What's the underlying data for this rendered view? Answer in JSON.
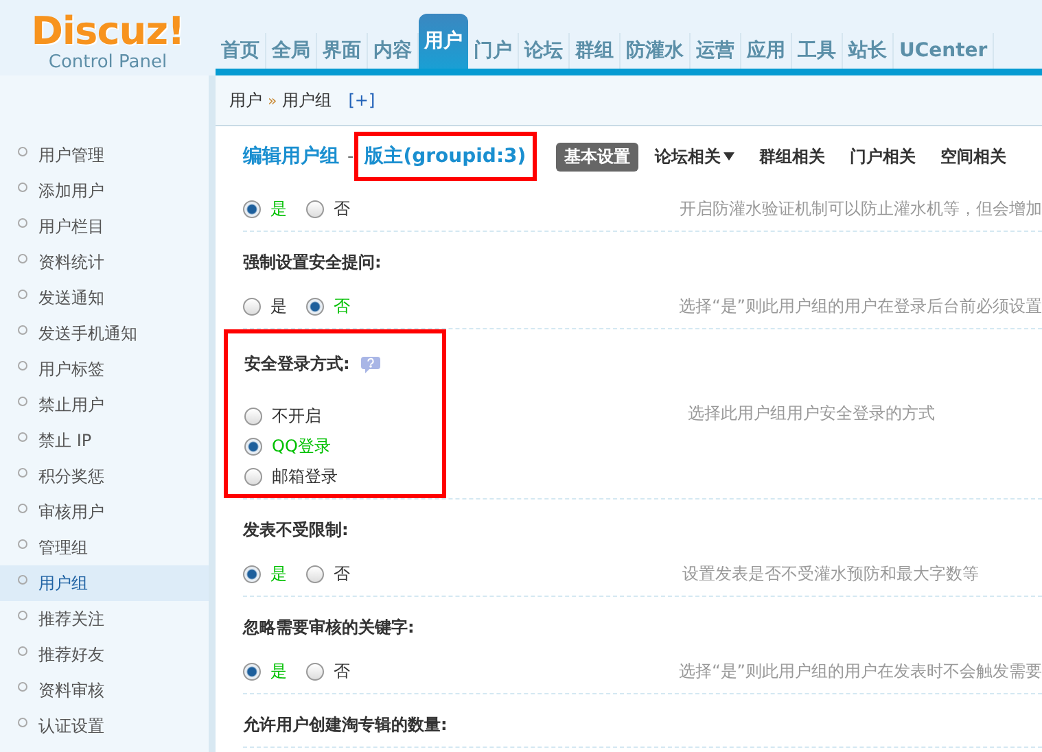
{
  "logo": {
    "name": "Discuz!",
    "subtitle": "Control Panel"
  },
  "nav": [
    {
      "label": "首页",
      "selected": false
    },
    {
      "label": "全局",
      "selected": false
    },
    {
      "label": "界面",
      "selected": false
    },
    {
      "label": "内容",
      "selected": false
    },
    {
      "label": "用户",
      "selected": true
    },
    {
      "label": "门户",
      "selected": false
    },
    {
      "label": "论坛",
      "selected": false
    },
    {
      "label": "群组",
      "selected": false
    },
    {
      "label": "防灌水",
      "selected": false
    },
    {
      "label": "运营",
      "selected": false
    },
    {
      "label": "应用",
      "selected": false
    },
    {
      "label": "工具",
      "selected": false
    },
    {
      "label": "站长",
      "selected": false
    },
    {
      "label": "UCenter",
      "selected": false
    }
  ],
  "breadcrumb": {
    "items": [
      "用户",
      "用户组"
    ],
    "separator": "»",
    "add": "[+]"
  },
  "sidebar": {
    "items": [
      {
        "label": "用户管理",
        "selected": false
      },
      {
        "label": "添加用户",
        "selected": false
      },
      {
        "label": "用户栏目",
        "selected": false
      },
      {
        "label": "资料统计",
        "selected": false
      },
      {
        "label": "发送通知",
        "selected": false
      },
      {
        "label": "发送手机通知",
        "selected": false
      },
      {
        "label": "用户标签",
        "selected": false
      },
      {
        "label": "禁止用户",
        "selected": false
      },
      {
        "label": "禁止 IP",
        "selected": false
      },
      {
        "label": "积分奖惩",
        "selected": false
      },
      {
        "label": "审核用户",
        "selected": false
      },
      {
        "label": "管理组",
        "selected": false
      },
      {
        "label": "用户组",
        "selected": true
      },
      {
        "label": "推荐关注",
        "selected": false
      },
      {
        "label": "推荐好友",
        "selected": false
      },
      {
        "label": "资料审核",
        "selected": false
      },
      {
        "label": "认证设置",
        "selected": false
      }
    ]
  },
  "title": {
    "text": "编辑用户组",
    "separator": "-",
    "group": "版主(groupid:3)",
    "highlighted": true
  },
  "subtabs": [
    {
      "label": "基本设置",
      "selected": true,
      "dropdown": false
    },
    {
      "label": "论坛相关",
      "selected": false,
      "dropdown": true
    },
    {
      "label": "群组相关",
      "selected": false,
      "dropdown": false
    },
    {
      "label": "门户相关",
      "selected": false,
      "dropdown": false
    },
    {
      "label": "空间相关",
      "selected": false,
      "dropdown": false
    }
  ],
  "settings": [
    {
      "kind": "inline",
      "highlighted": false,
      "options": [
        {
          "label": "是",
          "selected": true
        },
        {
          "label": "否",
          "selected": false
        }
      ],
      "description": "开启防灌水验证机制可以防止灌水机等，但会增加"
    },
    {
      "label": "强制设置安全提问:",
      "kind": "inline",
      "highlighted": false,
      "help": false,
      "options": [
        {
          "label": "是",
          "selected": false
        },
        {
          "label": "否",
          "selected": true
        }
      ],
      "description": "选择“是”则此用户组的用户在登录后台前必须设置"
    },
    {
      "label": "安全登录方式:",
      "kind": "stacked",
      "highlighted": true,
      "help": true,
      "options": [
        {
          "label": "不开启",
          "selected": false
        },
        {
          "label": "QQ登录",
          "selected": true
        },
        {
          "label": "邮箱登录",
          "selected": false
        }
      ],
      "description": "选择此用户组用户安全登录的方式"
    },
    {
      "label": "发表不受限制:",
      "kind": "inline",
      "highlighted": false,
      "help": false,
      "options": [
        {
          "label": "是",
          "selected": true
        },
        {
          "label": "否",
          "selected": false
        }
      ],
      "description": "设置发表是否不受灌水预防和最大字数等"
    },
    {
      "label": "忽略需要审核的关键字:",
      "kind": "inline",
      "highlighted": false,
      "help": false,
      "options": [
        {
          "label": "是",
          "selected": true
        },
        {
          "label": "否",
          "selected": false
        }
      ],
      "description": "选择“是”则此用户组的用户在发表时不会触发需要"
    },
    {
      "label": "允许用户创建淘专辑的数量:",
      "kind": "label",
      "highlighted": false,
      "help": false
    }
  ]
}
